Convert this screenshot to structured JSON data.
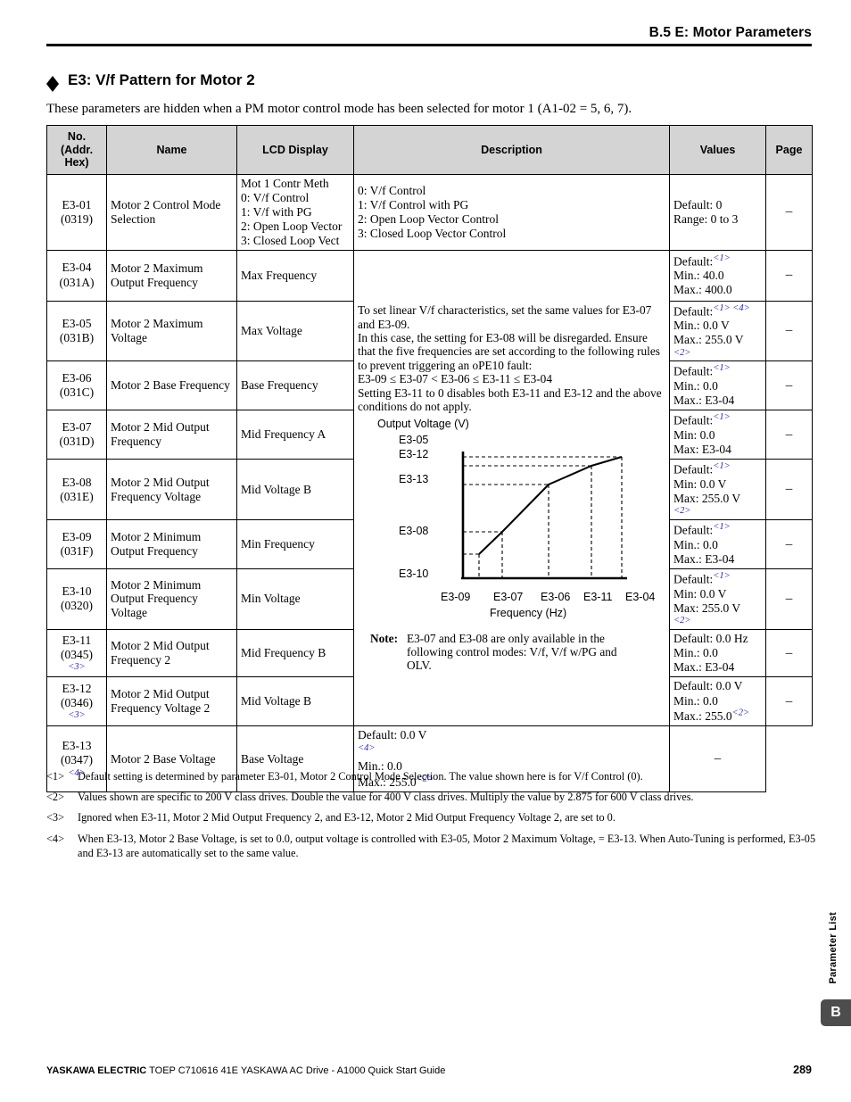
{
  "header": {
    "running_title": "B.5 E: Motor Parameters"
  },
  "section": {
    "title": "E3: V/f Pattern for Motor 2",
    "intro": "These parameters are hidden when a PM motor control mode has been selected for motor 1 (A1-02 = 5, 6, 7)."
  },
  "table": {
    "headers": {
      "no": "No.\n(Addr.\nHex)",
      "no_l1": "No.",
      "no_l2": "(Addr.",
      "no_l3": "Hex)",
      "name": "Name",
      "lcd": "LCD Display",
      "description": "Description",
      "values": "Values",
      "page": "Page"
    },
    "rows": [
      {
        "no": "E3-01",
        "addr": "(0319)",
        "fn": "",
        "name": "Motor 2 Control Mode Selection",
        "lcd": "Mot 1 Contr Meth\n0: V/f Control\n1: V/f with PG\n2: Open Loop Vector\n3: Closed Loop Vect",
        "description": "0: V/f Control\n1: V/f Control with PG\n2: Open Loop Vector Control\n3: Closed Loop Vector Control",
        "values": "Default: 0\nRange: 0 to 3",
        "page": "–"
      },
      {
        "no": "E3-04",
        "addr": "(031A)",
        "fn": "",
        "name": "Motor 2 Maximum Output Frequency",
        "lcd": "Max Frequency",
        "values_default": "Default:",
        "values_default_fn": "<1>",
        "values_min": "Min.: 40.0",
        "values_max": "Max.: 400.0",
        "page": "–"
      },
      {
        "no": "E3-05",
        "addr": "(031B)",
        "fn": "",
        "name": "Motor 2 Maximum Voltage",
        "lcd": "Max Voltage",
        "values_default": "Default:",
        "values_default_fn": "<1> <4>",
        "values_min": "Min.: 0.0 V",
        "values_max": "Max.: 255.0 V",
        "values_max_fn": "<2>",
        "page": "–"
      },
      {
        "no": "E3-06",
        "addr": "(031C)",
        "fn": "",
        "name": "Motor 2 Base Frequency",
        "lcd": "Base Frequency",
        "values_default": "Default:",
        "values_default_fn": "<1>",
        "values_min": "Min.: 0.0",
        "values_max": "Max.: E3-04",
        "page": "–"
      },
      {
        "no": "E3-07",
        "addr": "(031D)",
        "fn": "",
        "name": "Motor 2 Mid Output Frequency",
        "lcd": "Mid Frequency A",
        "values_default": "Default:",
        "values_default_fn": "<1>",
        "values_min": "Min: 0.0",
        "values_max": "Max: E3-04",
        "page": "–"
      },
      {
        "no": "E3-08",
        "addr": "(031E)",
        "fn": "",
        "name": "Motor 2 Mid Output Frequency Voltage",
        "lcd": "Mid Voltage B",
        "values_default": "Default:",
        "values_default_fn": "<1>",
        "values_min": "Min: 0.0 V",
        "values_max": "Max: 255.0 V",
        "values_max_fn": "<2>",
        "page": "–"
      },
      {
        "no": "E3-09",
        "addr": "(031F)",
        "fn": "",
        "name": "Motor 2 Minimum Output Frequency",
        "lcd": "Min Frequency",
        "values_default": "Default:",
        "values_default_fn": "<1>",
        "values_min": "Min.: 0.0",
        "values_max": "Max.: E3-04",
        "page": "–"
      },
      {
        "no": "E3-10",
        "addr": "(0320)",
        "fn": "",
        "name": "Motor 2 Minimum Output Frequency Voltage",
        "lcd": "Min Voltage",
        "values_default": "Default:",
        "values_default_fn": "<1>",
        "values_min": "Min: 0.0 V",
        "values_max": "Max: 255.0 V",
        "values_max_fn": "<2>",
        "page": "–"
      },
      {
        "no": "E3-11",
        "addr": "(0345)",
        "fn": "<3>",
        "name": "Motor 2 Mid Output Frequency 2",
        "lcd": "Mid Frequency B",
        "values_default": "Default: 0.0 Hz",
        "values_default_fn": "",
        "values_min": "Min.: 0.0",
        "values_max": "Max.: E3-04",
        "page": "–"
      },
      {
        "no": "E3-12",
        "addr": "(0346)",
        "fn": "<3>",
        "name": "Motor 2 Mid Output Frequency Voltage 2",
        "lcd": "Mid Voltage B",
        "values_default": "Default: 0.0 V",
        "values_default_fn": "",
        "values_min": "Min.: 0.0",
        "values_max": "Max.: 255.0",
        "values_max_fn": "<2>",
        "page": "–"
      },
      {
        "no": "E3-13",
        "addr": "(0347)",
        "fn": "<4>",
        "name": "Motor 2 Base Voltage",
        "lcd": "Base Voltage",
        "values_default": "Default: 0.0 V",
        "values_default_fn": "<4>",
        "values_min": "Min.: 0.0",
        "values_max": "Max.: 255.0",
        "values_max_fn": "<2>",
        "page": "–"
      }
    ],
    "description_block": {
      "para1": "To set linear V/f characteristics, set the same values for E3-07 and E3-09.",
      "para2": "In this case, the setting for E3-08 will be disregarded. Ensure that the five frequencies are set according to the following rules to prevent triggering an oPE10 fault:",
      "para3": "E3-09 ≤ E3-07 < E3-06 ≤ E3-11 ≤ E3-04",
      "para4": "Setting E3-11 to 0 disables both E3-11 and E3-12 and the above conditions do not apply.",
      "note_label": "Note:",
      "note_text": "E3-07 and E3-08 are only available in the following control modes: V/f, V/f w/PG and OLV."
    }
  },
  "chart_data": {
    "type": "line",
    "title": "V/f Pattern for Motor 2",
    "xlabel": "Frequency (Hz)",
    "ylabel": "Output Voltage (V)",
    "x_tick_labels": [
      "E3-09",
      "E3-07",
      "E3-06",
      "E3-11",
      "E3-04"
    ],
    "y_tick_labels": [
      "E3-05",
      "E3-12",
      "E3-13",
      "E3-08",
      "E3-10"
    ],
    "x": [
      0.1,
      0.33,
      0.53,
      0.72,
      0.95
    ],
    "y": [
      0.1,
      0.33,
      0.62,
      0.82,
      0.93
    ],
    "series": [
      {
        "name": "V/f pattern",
        "points": [
          {
            "x_label": "E3-09",
            "y_label": "E3-10",
            "x": 0.1,
            "y": 0.1
          },
          {
            "x_label": "E3-07",
            "y_label": "E3-08",
            "x": 0.33,
            "y": 0.33
          },
          {
            "x_label": "E3-06",
            "y_label": "E3-13",
            "x": 0.53,
            "y": 0.62
          },
          {
            "x_label": "E3-11",
            "y_label": "E3-12",
            "x": 0.72,
            "y": 0.82
          },
          {
            "x_label": "E3-04",
            "y_label": "E3-05",
            "x": 0.95,
            "y": 0.93
          }
        ]
      }
    ],
    "grid": false,
    "dashed_guides": true,
    "legend": "none"
  },
  "footnotes": [
    {
      "mark": "<1>",
      "text": "Default setting is determined by parameter E3-01, Motor 2 Control Mode Selection. The value shown here is for V/f Control (0)."
    },
    {
      "mark": "<2>",
      "text": "Values shown are specific to 200 V class drives. Double the value for 400 V class drives. Multiply the value by 2.875 for 600 V class drives."
    },
    {
      "mark": "<3>",
      "text": "Ignored when E3-11, Motor 2 Mid Output Frequency 2, and E3-12, Motor 2 Mid Output Frequency Voltage 2, are set to 0."
    },
    {
      "mark": "<4>",
      "text": "When E3-13, Motor 2 Base Voltage, is set to 0.0, output voltage is controlled with E3-05, Motor 2 Maximum Voltage, = E3-13. When Auto-Tuning is performed, E3-05 and E3-13 are automatically set to the same value."
    }
  ],
  "side": {
    "tab_label": "Parameter List",
    "tab_letter": "B"
  },
  "footer": {
    "brand": "YASKAWA ELECTRIC",
    "document": "TOEP C710616 41E YASKAWA AC Drive - A1000 Quick Start Guide",
    "page_number": "289"
  }
}
